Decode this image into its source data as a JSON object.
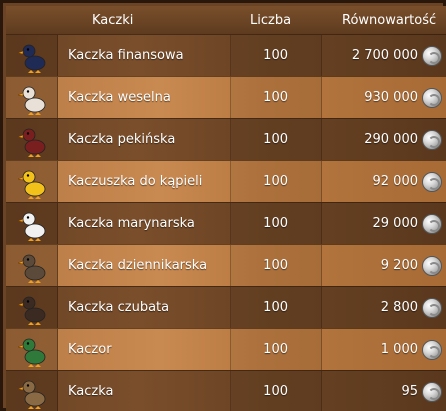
{
  "header": {
    "name": "Kaczki",
    "count": "Liczba",
    "value": "Równowartość"
  },
  "rows": [
    {
      "name": "Kaczka finansowa",
      "count": "100",
      "value": "2 700 000",
      "icon": "finance-duck-icon",
      "accent": "#1f2a55"
    },
    {
      "name": "Kaczka weselna",
      "count": "100",
      "value": "930 000",
      "icon": "wedding-duck-icon",
      "accent": "#e9e0d8"
    },
    {
      "name": "Kaczka pekińska",
      "count": "100",
      "value": "290 000",
      "icon": "peking-duck-icon",
      "accent": "#7a1f1f"
    },
    {
      "name": "Kaczuszka do kąpieli",
      "count": "100",
      "value": "92 000",
      "icon": "rubber-duck-icon",
      "accent": "#f2c21a"
    },
    {
      "name": "Kaczka marynarska",
      "count": "100",
      "value": "29 000",
      "icon": "sailor-duck-icon",
      "accent": "#f1f1f1"
    },
    {
      "name": "Kaczka dziennikarska",
      "count": "100",
      "value": "9 200",
      "icon": "journalist-duck-icon",
      "accent": "#5b4a3a"
    },
    {
      "name": "Kaczka czubata",
      "count": "100",
      "value": "2 800",
      "icon": "crested-duck-icon",
      "accent": "#3a2a22"
    },
    {
      "name": "Kaczor",
      "count": "100",
      "value": "1 000",
      "icon": "drake-icon",
      "accent": "#2f7a3a"
    },
    {
      "name": "Kaczka",
      "count": "100",
      "value": "95",
      "icon": "duck-icon",
      "accent": "#8a6a44"
    }
  ]
}
